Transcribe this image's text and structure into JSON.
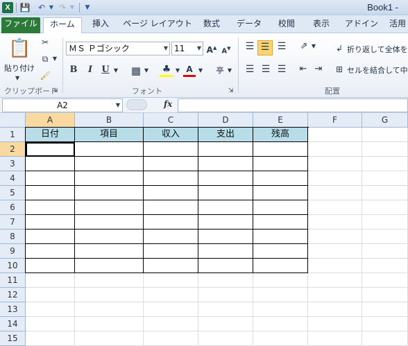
{
  "window": {
    "title": "Book1 - "
  },
  "quick_access": {
    "icons": [
      "excel-app-icon",
      "save-icon",
      "undo-icon",
      "redo-icon",
      "customize-icon"
    ]
  },
  "tabs": [
    {
      "label": "ファイル"
    },
    {
      "label": "ホーム"
    },
    {
      "label": "挿入"
    },
    {
      "label": "ページ レイアウト"
    },
    {
      "label": "数式"
    },
    {
      "label": "データ"
    },
    {
      "label": "校閲"
    },
    {
      "label": "表示"
    },
    {
      "label": "アドイン"
    },
    {
      "label": "活用"
    }
  ],
  "ribbon": {
    "clipboard": {
      "paste_label": "貼り付け",
      "group_label": "クリップボード"
    },
    "font": {
      "family": "ＭＳ Ｐゴシック",
      "size": "11",
      "group_label": "フォント",
      "bold": "B",
      "italic": "I",
      "underline": "U",
      "font_color_letter": "A"
    },
    "alignment": {
      "wrap_label": "折り返して全体を表",
      "merge_label": "セルを結合して中央",
      "group_label": "配置"
    }
  },
  "formula_bar": {
    "name_box": "A2",
    "fx": "fx",
    "formula": ""
  },
  "sheet": {
    "columns": [
      "A",
      "B",
      "C",
      "D",
      "E",
      "F",
      "G"
    ],
    "rows": [
      "1",
      "2",
      "3",
      "4",
      "5",
      "6",
      "7",
      "8",
      "9",
      "10",
      "11",
      "12",
      "13",
      "14",
      "15"
    ],
    "header_cells": [
      "日付",
      "項目",
      "収入",
      "支出",
      "残高"
    ],
    "active_cell": "A2",
    "header_fill": "#b7dde8"
  }
}
